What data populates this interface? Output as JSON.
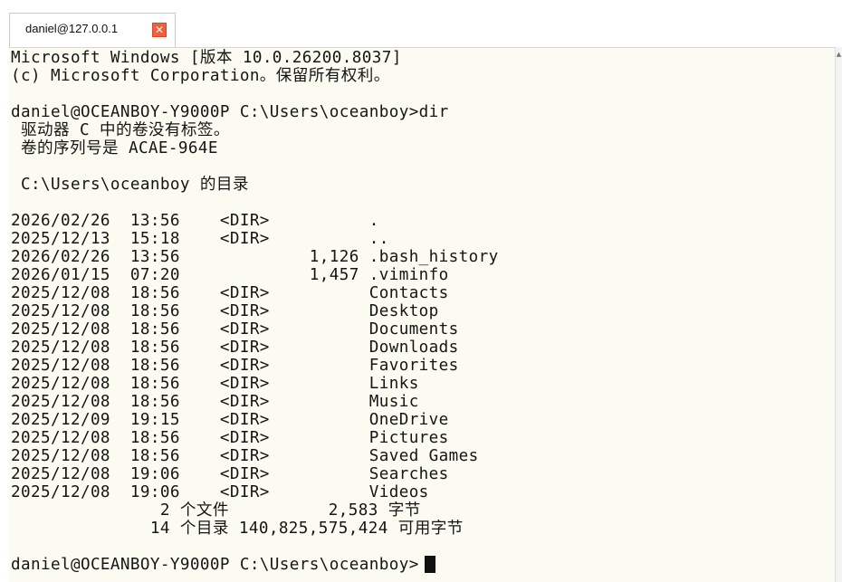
{
  "tab": {
    "title": "daniel@127.0.0.1",
    "close_icon": "close-icon",
    "close_glyph": "✕"
  },
  "terminal": {
    "header_line1": "Microsoft Windows [版本 10.0.26200.8037]",
    "header_line2": "(c) Microsoft Corporation。保留所有权利。",
    "prompt_dir": "daniel@OCEANBOY-Y9000P C:\\Users\\oceanboy>dir",
    "vol_label": " 驱动器 C 中的卷没有标签。",
    "vol_serial": " 卷的序列号是 ACAE-964E",
    "dir_of": " C:\\Users\\oceanboy 的目录",
    "entries": [
      "2026/02/26  13:56    <DIR>          .",
      "2025/12/13  15:18    <DIR>          ..",
      "2026/02/26  13:56             1,126 .bash_history",
      "2026/01/15  07:20             1,457 .viminfo",
      "2025/12/08  18:56    <DIR>          Contacts",
      "2025/12/08  18:56    <DIR>          Desktop",
      "2025/12/08  18:56    <DIR>          Documents",
      "2025/12/08  18:56    <DIR>          Downloads",
      "2025/12/08  18:56    <DIR>          Favorites",
      "2025/12/08  18:56    <DIR>          Links",
      "2025/12/08  18:56    <DIR>          Music",
      "2025/12/09  19:15    <DIR>          OneDrive",
      "2025/12/08  18:56    <DIR>          Pictures",
      "2025/12/08  18:56    <DIR>          Saved Games",
      "2025/12/08  19:06    <DIR>          Searches",
      "2025/12/08  19:06    <DIR>          Videos"
    ],
    "summary_files": "               2 个文件          2,583 字节",
    "summary_dirs": "              14 个目录 140,825,575,424 可用字节",
    "prompt_final": "daniel@OCEANBOY-Y9000P C:\\Users\\oceanboy>"
  },
  "scrollbar": {
    "up_icon": "scroll-up-arrow-icon",
    "up_glyph": "▲"
  },
  "colors": {
    "terminal_bg": "#fbfbf1",
    "text": "#151515",
    "tab_close": "#f0603c"
  }
}
